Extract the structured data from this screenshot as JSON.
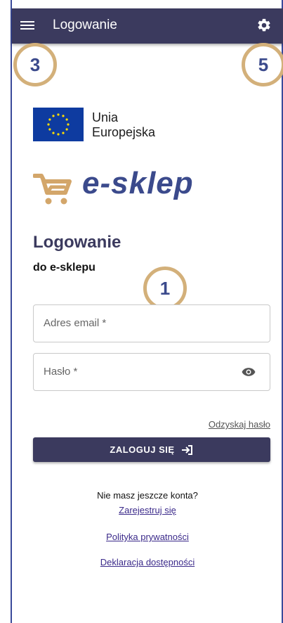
{
  "appbar": {
    "title": "Logowanie",
    "menu_icon": "hamburger-menu-icon",
    "settings_icon": "gear-icon",
    "background": "#3b3a5e"
  },
  "badges": {
    "menu": "3",
    "settings": "5",
    "form": "1",
    "color": "#d3b07a"
  },
  "eu": {
    "line1": "Unia",
    "line2": "Europejska"
  },
  "brand": {
    "name": "e-sklep",
    "cart_icon": "cart-icon",
    "accent": "#d3a66a",
    "primary": "#3b4a8c"
  },
  "login": {
    "title": "Logowanie",
    "subtitle": "do e-sklepu",
    "email_placeholder": "Adres email *",
    "password_placeholder": "Hasło *",
    "recover_link": "Odzyskaj hasło",
    "submit_label": "ZALOGUJ SIĘ"
  },
  "footer": {
    "no_account": "Nie masz jeszcze konta?",
    "register_link": "Zarejestruj się",
    "privacy_link": "Polityka prywatności",
    "accessibility_link": "Deklaracja dostępności"
  }
}
